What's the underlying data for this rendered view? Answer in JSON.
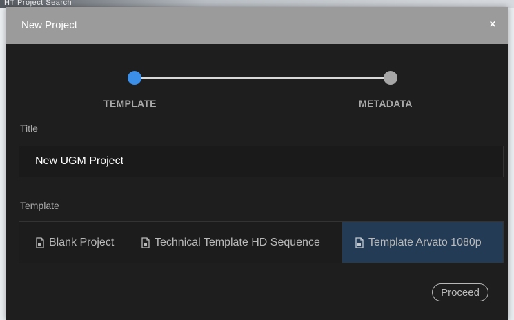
{
  "backdrop": {
    "text": "HT Project Search"
  },
  "dialog": {
    "title": "New Project",
    "close_label": "×"
  },
  "stepper": {
    "steps": [
      {
        "label": "TEMPLATE",
        "active": true
      },
      {
        "label": "METADATA",
        "active": false
      }
    ],
    "active_color": "#3b8fe8",
    "inactive_color": "#a6a6a6"
  },
  "form": {
    "title_label": "Title",
    "title_value": "New UGM Project",
    "template_label": "Template",
    "templates": [
      {
        "label": "Blank Project",
        "icon": "document-icon",
        "selected": false
      },
      {
        "label": "Technical Template HD Sequence",
        "icon": "document-icon",
        "selected": false
      },
      {
        "label": "Template Arvato 1080p",
        "icon": "document-icon",
        "selected": true
      }
    ],
    "selected_color": "#233b55"
  },
  "footer": {
    "proceed_label": "Proceed"
  }
}
